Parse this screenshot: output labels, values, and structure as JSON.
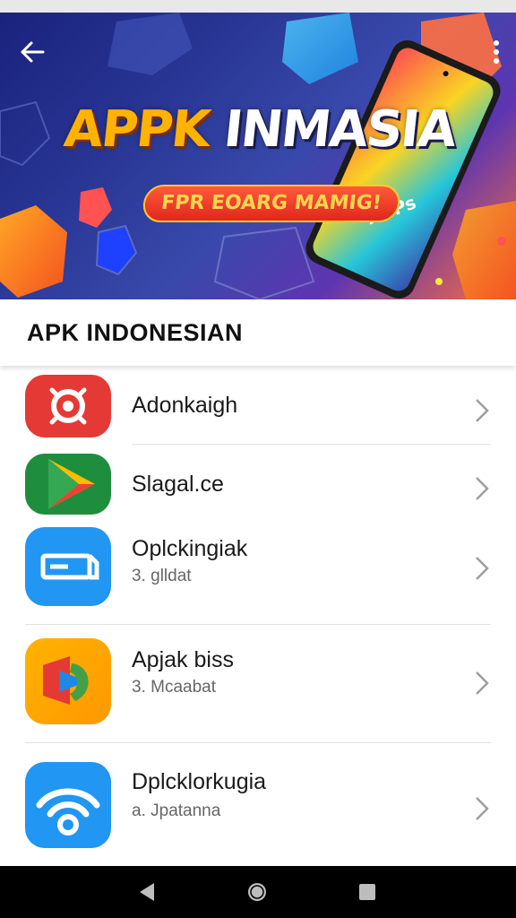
{
  "header": {
    "banner_title_1": "APPK",
    "banner_title_2": " INMASIA",
    "banner_subtitle": "FPR EOARG MAMIG!",
    "phone_screen_text": "APPs"
  },
  "section": {
    "title": "APK INDONESIAN"
  },
  "apps": [
    {
      "title": "Adonkaigh",
      "subtitle": "",
      "icon": "search-target-icon"
    },
    {
      "title": "Slagal.ce",
      "subtitle": "",
      "icon": "play-store-icon"
    },
    {
      "title": "Oplckingiak",
      "subtitle": "3. glldat",
      "icon": "card-icon"
    },
    {
      "title": "Apjak biss",
      "subtitle": "3. Mcaabat",
      "icon": "arrow-play-icon"
    },
    {
      "title": "Dplcklorkugia",
      "subtitle": "a. Jpatanna",
      "icon": "wifi-icon"
    }
  ],
  "colors": {
    "banner_start": "#1a237e",
    "banner_end": "#ff6f3c",
    "title_orange": "#ffb300",
    "pill_red": "#e0271c",
    "navbar": "#000000"
  },
  "nav": {
    "back": "back-icon",
    "home": "home-icon",
    "recents": "recents-icon"
  }
}
